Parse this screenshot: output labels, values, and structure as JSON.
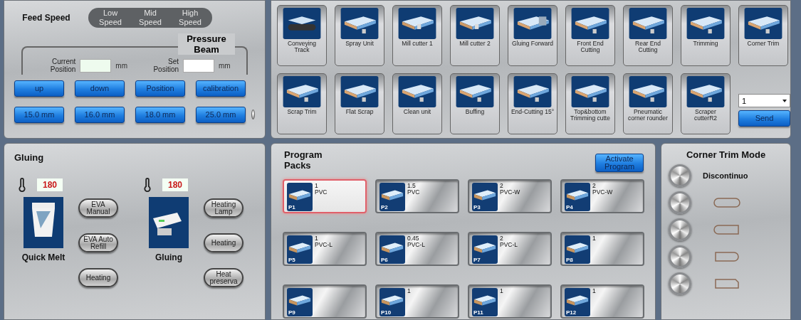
{
  "feed_speed": {
    "label": "Feed Speed",
    "options": [
      {
        "label": "Low Speed"
      },
      {
        "label": "Mid Speed"
      },
      {
        "label": "High Speed"
      }
    ]
  },
  "pressure_beam": {
    "title": "Pressure Beam",
    "fields": [
      {
        "label": "Current Position",
        "kind": "current",
        "unit": "mm"
      },
      {
        "label": "Set Position",
        "kind": "set",
        "unit": "mm"
      }
    ],
    "buttons": [
      "up",
      "down",
      "Position",
      "calibration"
    ],
    "presets": [
      "15.0 mm",
      "16.0 mm",
      "18.0 mm",
      "25.0 mm"
    ]
  },
  "units": [
    {
      "label": "Conveying Track",
      "kind": "track"
    },
    {
      "label": "Spray Unit",
      "kind": "tool"
    },
    {
      "label": "Mill cutter 1",
      "kind": "mill"
    },
    {
      "label": "Mill cutter 2",
      "kind": "mill"
    },
    {
      "label": "Gluing Forward",
      "kind": "glue"
    },
    {
      "label": "Front End Cutting",
      "kind": "tool"
    },
    {
      "label": "Rear End Cutting",
      "kind": "tool"
    },
    {
      "label": "Trimming",
      "kind": "tool"
    },
    {
      "label": "Corner Trim",
      "kind": "tool"
    },
    {
      "label": "Scrap Trim",
      "kind": "tool"
    },
    {
      "label": "Flat Scrap",
      "kind": "tool"
    },
    {
      "label": "Clean unit",
      "kind": "tool"
    },
    {
      "label": "Buffing",
      "kind": "tool"
    },
    {
      "label": "End-Cutting 15°",
      "kind": "tool"
    },
    {
      "label": "Top&bottom Trimming cutte",
      "kind": "tool"
    },
    {
      "label": "Pneumatic corner rounder",
      "kind": "tool"
    },
    {
      "label": "Scraper cutterR2",
      "kind": "tool"
    }
  ],
  "send": {
    "value": "1",
    "button": "Send"
  },
  "gluing": {
    "title": "Gluing",
    "stations": [
      {
        "temperature": "180",
        "name": "Quick Melt",
        "kind": "melter",
        "buttons": [
          "EVA Manual",
          "EVA Auto Refill",
          "Heating"
        ]
      },
      {
        "temperature": "180",
        "name": "Gluing",
        "kind": "gluer",
        "buttons": [
          "Heating Lamp",
          "Heating",
          "Heat preserva"
        ]
      }
    ]
  },
  "program_packs": {
    "title": "Program Packs",
    "activate": "Activate Program",
    "packs": [
      {
        "id": "P1",
        "thickness": "1",
        "material": "PVC",
        "selected": true
      },
      {
        "id": "P2",
        "thickness": "1.5",
        "material": "PVC",
        "selected": false
      },
      {
        "id": "P3",
        "thickness": "2",
        "material": "PVC-W",
        "selected": false
      },
      {
        "id": "P4",
        "thickness": "2",
        "material": "PVC-W",
        "selected": false
      },
      {
        "id": "P5",
        "thickness": "1",
        "material": "PVC-L",
        "selected": false
      },
      {
        "id": "P6",
        "thickness": "0.45",
        "material": "PVC-L",
        "selected": false
      },
      {
        "id": "P7",
        "thickness": "2",
        "material": "PVC-L",
        "selected": false
      },
      {
        "id": "P8",
        "thickness": "1",
        "selected": false
      },
      {
        "id": "P9",
        "selected": false
      },
      {
        "id": "P10",
        "thickness": "1",
        "selected": false
      },
      {
        "id": "P11",
        "thickness": "1",
        "selected": false
      },
      {
        "id": "P12",
        "thickness": "1",
        "selected": false
      }
    ]
  },
  "corner_trim": {
    "title": "Corner Trim Mode",
    "modes": [
      {
        "kind": "text",
        "label": "Discontinuo"
      },
      {
        "kind": "pill"
      },
      {
        "kind": "round-left"
      },
      {
        "kind": "round-right"
      },
      {
        "kind": "chamfer-right"
      }
    ]
  }
}
